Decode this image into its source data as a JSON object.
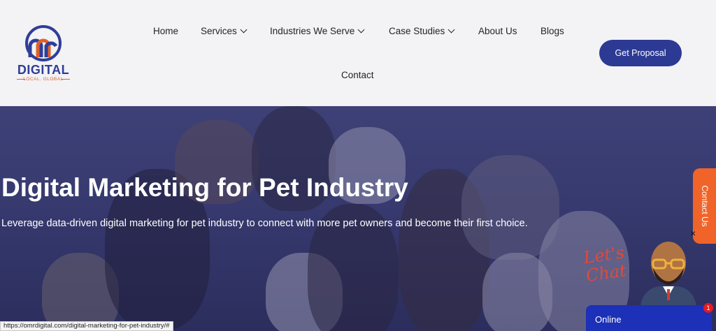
{
  "logo": {
    "brand": "DIGITAL",
    "tagline": "LOCAL. GLOBAL"
  },
  "nav": {
    "home": "Home",
    "services": "Services",
    "industries": "Industries We Serve",
    "case_studies": "Case Studies",
    "about": "About Us",
    "blogs": "Blogs",
    "contact": "Contact"
  },
  "cta": {
    "label": "Get Proposal"
  },
  "hero": {
    "title": "Digital Marketing for Pet Industry",
    "subtitle": "Leverage data-driven digital marketing for pet industry to connect with more pet owners and become their first choice."
  },
  "side_tab": {
    "label": "Contact Us",
    "close": "×"
  },
  "chat": {
    "prompt": "Let's Chat",
    "status": "Online",
    "badge": "1"
  },
  "status_bar": {
    "url": "https://omrdigital.com/digital-marketing-for-pet-industry/#"
  },
  "colors": {
    "brand_blue": "#2c3a94",
    "accent_orange": "#f0642a",
    "chat_blue": "#1c30b8"
  }
}
